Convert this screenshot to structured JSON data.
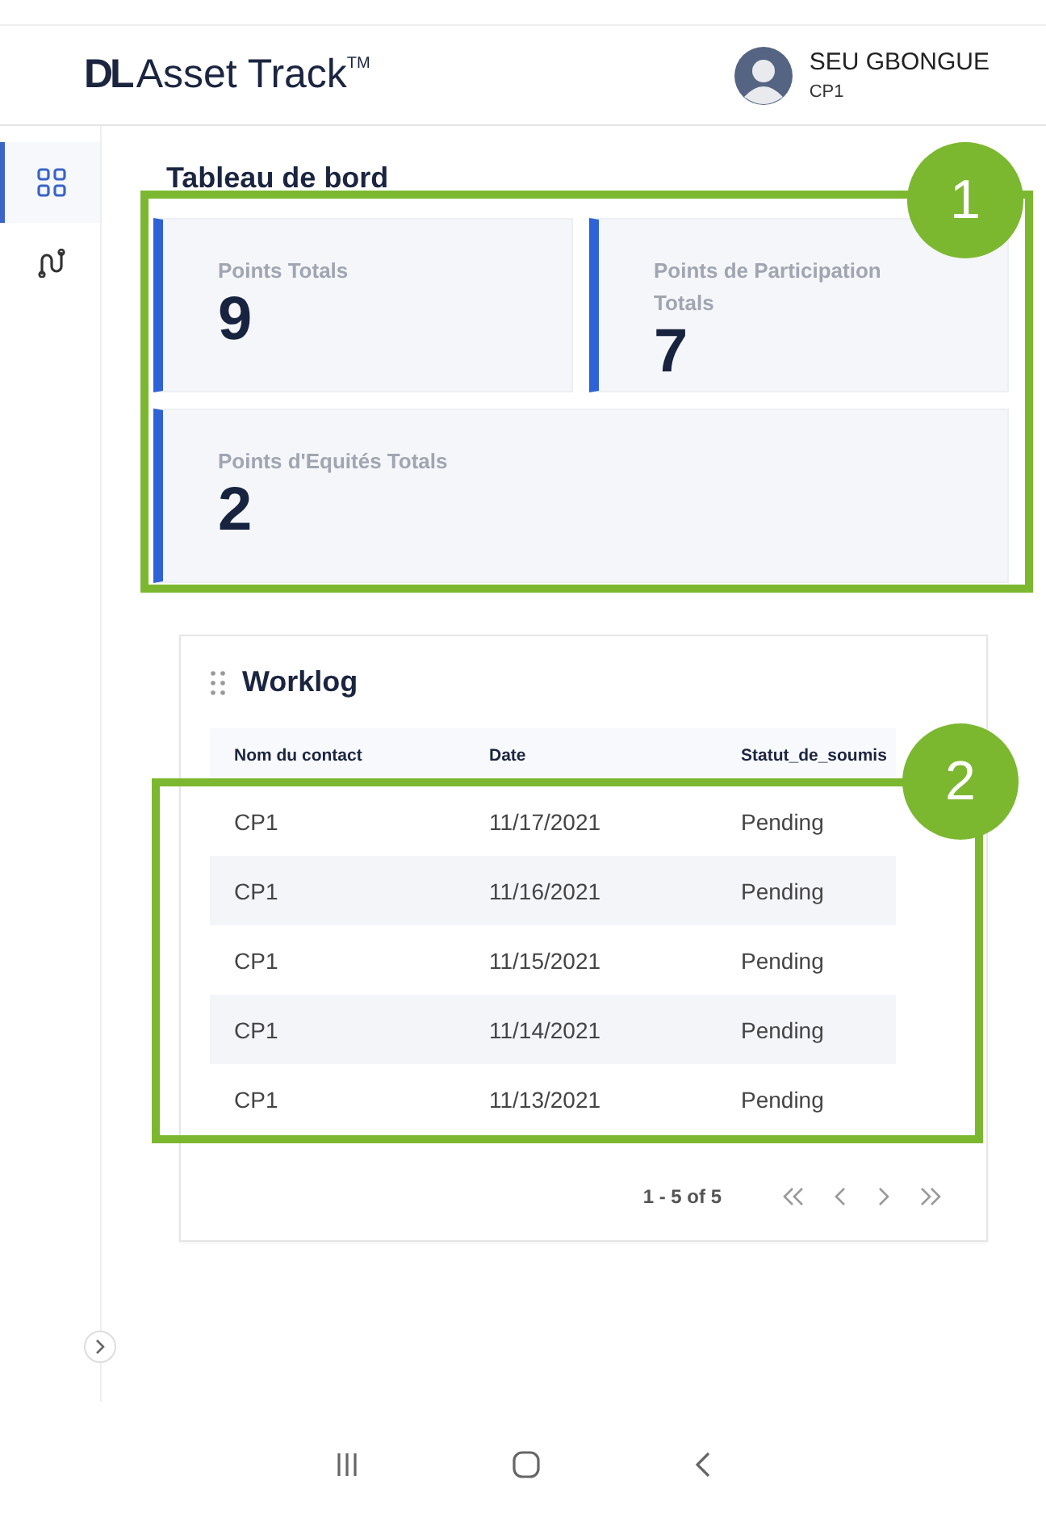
{
  "header": {
    "logo_mark": "DL",
    "logo_text": "Asset Track",
    "logo_tm": "TM",
    "user_name": "SEU GBONGUE",
    "user_role": "CP1"
  },
  "sidebar": {
    "items": [
      {
        "kind": "dashboard",
        "selected": true
      },
      {
        "kind": "route",
        "selected": false
      }
    ]
  },
  "dashboard": {
    "title": "Tableau de bord",
    "callout": "1",
    "stats": [
      {
        "label": "Points Totals",
        "value": "9"
      },
      {
        "label": "Points de Participation Totals",
        "value": "7"
      },
      {
        "label": "Points d'Equités Totals",
        "value": "2"
      }
    ]
  },
  "worklog": {
    "title": "Worklog",
    "callout": "2",
    "columns": [
      "Nom du contact",
      "Date",
      "Statut_de_soumis"
    ],
    "rows": [
      [
        "CP1",
        "11/17/2021",
        "Pending"
      ],
      [
        "CP1",
        "11/16/2021",
        "Pending"
      ],
      [
        "CP1",
        "11/15/2021",
        "Pending"
      ],
      [
        "CP1",
        "11/14/2021",
        "Pending"
      ],
      [
        "CP1",
        "11/13/2021",
        "Pending"
      ]
    ],
    "range": "1 - 5 of 5"
  }
}
